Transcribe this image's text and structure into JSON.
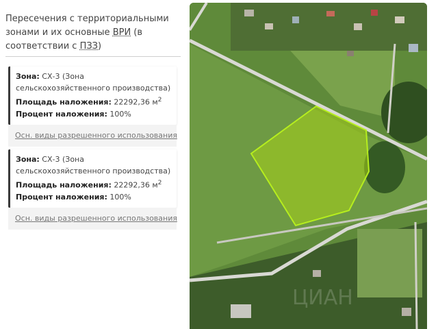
{
  "panel": {
    "title_line1": "Пересечения с территориальными",
    "title_line2": "зонами и их основные ",
    "title_abbr": "ВРИ",
    "title_line2_end": " (в",
    "title_line3": "соответствии с ",
    "title_abbr2": "ПЗЗ",
    "title_line3_end": ")"
  },
  "cards": [
    {
      "zone_label": "Зона:",
      "zone_value": " СХ-3 (Зона сельскохозяйственного производства)",
      "area_label": "Площадь наложения:",
      "area_value": " 22292,36 м",
      "area_sup": "2",
      "percent_label": "Процент наложения:",
      "percent_value": " 100%",
      "link": "Осн. виды разрешенного использования"
    },
    {
      "zone_label": "Зона:",
      "zone_value": " СХ-3 (Зона сельскохозяйственного производства)",
      "area_label": "Площадь наложения:",
      "area_value": " 22292,36 м",
      "area_sup": "2",
      "percent_label": "Процент наложения:",
      "percent_value": " 100%",
      "link": "Осн. виды разрешенного использования"
    }
  ],
  "map": {
    "parcel_fill": "#a8d11a",
    "parcel_stroke": "#b6ee1e",
    "road_color": "#d9d9d4",
    "field_color": "#5f8a3a",
    "forest_color": "#2f4f20",
    "watermark": "ЦИАН"
  }
}
